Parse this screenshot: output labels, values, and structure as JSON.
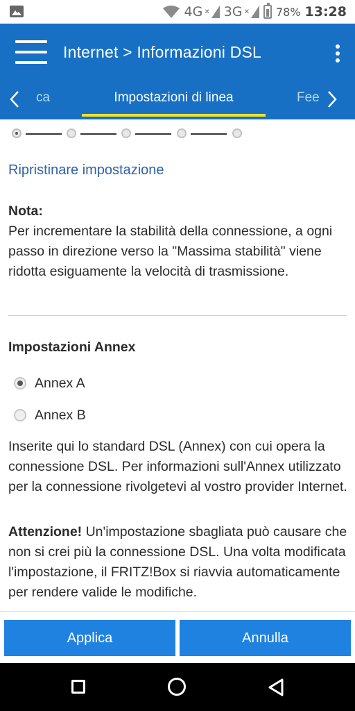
{
  "status_bar": {
    "network_1": "4G",
    "network_2": "3G",
    "battery": "78%",
    "time": "13:28",
    "icons": [
      "image-icon",
      "wifi-icon",
      "signal-4g-icon",
      "signal-3g-icon",
      "battery-icon"
    ]
  },
  "appbar": {
    "title": "Internet > Informazioni DSL",
    "background": "#1770c4",
    "accent": "#f0e22e"
  },
  "tabs": {
    "prev_label": "ca",
    "active_label": "Impostazioni di linea",
    "next_label": "Fee"
  },
  "stepper": {
    "steps": 5,
    "selected_index": 0
  },
  "reset_link": "Ripristinare impostazione",
  "note": {
    "heading": "Nota:",
    "body": "Per incrementare la stabilità della connessione, a ogni passo in direzione verso la \"Massima stabilità\" viene ridotta esiguamente la velocità di trasmissione."
  },
  "annex": {
    "heading": "Impostazioni Annex",
    "options": [
      {
        "label": "Annex A",
        "selected": true
      },
      {
        "label": "Annex B",
        "selected": false
      }
    ],
    "description": "Inserite qui lo standard DSL (Annex) con cui opera la connessione DSL. Per informazioni sull'Annex utilizzato per la connessione rivolgetevi al vostro provider Internet.",
    "warning_label": "Attenzione!",
    "warning_text": " Un'impostazione sbagliata può causare che non si crei più la connessione DSL. Una volta modificata l'impostazione, il FRITZ!Box si riavvia automaticamente per rendere valide le modifiche."
  },
  "buttons": {
    "apply": "Applica",
    "cancel": "Annulla",
    "color": "#1f82e0"
  }
}
